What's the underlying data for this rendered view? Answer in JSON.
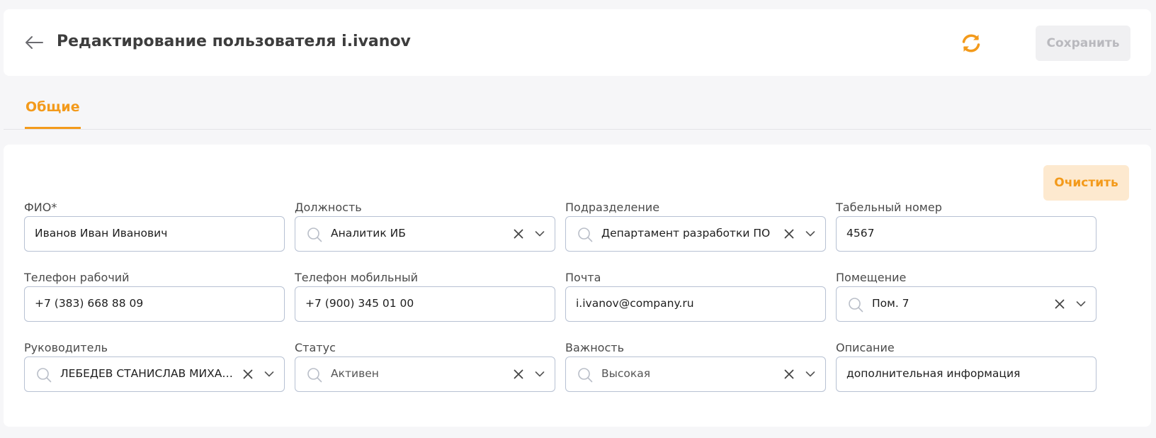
{
  "header": {
    "title": "Редактирование пользователя i.ivanov",
    "save_label": "Сохранить"
  },
  "tabs": [
    {
      "label": "Общие",
      "active": true
    }
  ],
  "form": {
    "clear_label": "Очистить",
    "fields": {
      "fio": {
        "label": "ФИО*",
        "value": "Иванов Иван Иванович"
      },
      "position": {
        "label": "Должность",
        "value": "Аналитик ИБ"
      },
      "department": {
        "label": "Подразделение",
        "value": "Департамент разработки ПО"
      },
      "employee_number": {
        "label": "Табельный номер",
        "value": "4567"
      },
      "work_phone": {
        "label": "Телефон рабочий",
        "value": "+7 (383) 668 88 09"
      },
      "mobile_phone": {
        "label": "Телефон мобильный",
        "value": "+7 (900) 345 01 00"
      },
      "email": {
        "label": "Почта",
        "value": "i.ivanov@company.ru"
      },
      "room": {
        "label": "Помещение",
        "value": "Пом. 7"
      },
      "manager": {
        "label": "Руководитель",
        "value": "ЛЕБЕДЕВ СТАНИСЛАВ МИХАЙЛОВИЧ"
      },
      "status": {
        "label": "Статус",
        "value": "Активен"
      },
      "priority": {
        "label": "Важность",
        "value": "Высокая"
      },
      "description": {
        "label": "Описание",
        "value": "дополнительная информация"
      }
    }
  },
  "colors": {
    "accent": "#f39a1b",
    "accent_light": "#fde9cf",
    "border": "#b7c1d3",
    "disabled_bg": "#f0f0f2",
    "disabled_text": "#b9b9be"
  },
  "icons": {
    "back": "arrow-left-icon",
    "refresh": "refresh-icon",
    "search": "search-icon",
    "clear": "close-icon",
    "dropdown": "chevron-down-icon"
  }
}
